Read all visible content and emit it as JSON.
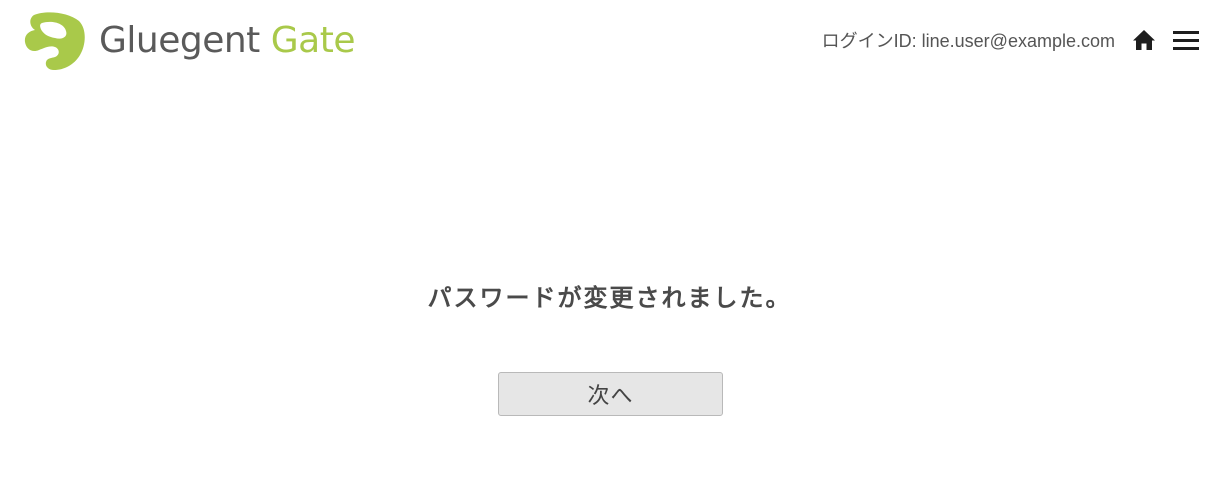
{
  "header": {
    "logo": {
      "word1": "Gluegent",
      "word2": "Gate",
      "brand_green": "#a9c94a",
      "brand_gray": "#5a5a5a"
    },
    "login_info": "ログインID: line.user@example.com",
    "home_icon": "home-icon",
    "menu_icon": "hamburger-menu-icon"
  },
  "main": {
    "message": "パスワードが変更されました。",
    "next_button_label": "次へ"
  }
}
